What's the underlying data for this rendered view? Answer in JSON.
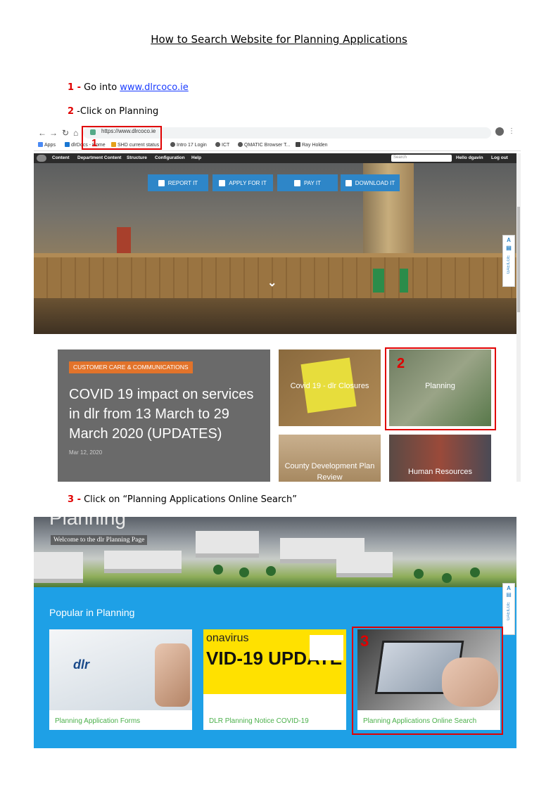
{
  "doc": {
    "title": "How to Search Website for Planning Applications",
    "step1": {
      "num": "1 -",
      "text": " Go into ",
      "link": "www.dlrcoco.ie"
    },
    "step2": {
      "num": "2",
      "text": " -Click on Planning"
    },
    "step3": {
      "num": "3 -",
      "text": " Click on “Planning Applications Online Search”"
    }
  },
  "shot1": {
    "url": "https://www.dlrcoco.ie",
    "bookmarks": [
      "Apps",
      "dlrDocs - Home",
      "SHD current status",
      "Intro 17 Login",
      "ICT",
      "QMATIC Browser T...",
      "Ray Holden"
    ],
    "admin": {
      "items": [
        "Content",
        "Department Content",
        "Structure",
        "Configuration",
        "Help"
      ],
      "search_placeholder": "Search",
      "hello": "Hello dgavin",
      "logout": "Log out"
    },
    "buttons": [
      "REPORT IT",
      "APPLY FOR IT",
      "PAY IT",
      "DOWNLOAD IT"
    ],
    "side_a": "A",
    "side_gaeilge": "GAEILGE",
    "news": {
      "tag": "CUSTOMER CARE & COMMUNICATIONS",
      "headline": "COVID 19 impact on services in dlr from 13 March to 29 March 2020 (UPDATES)",
      "date": "Mar 12, 2020"
    },
    "tiles": [
      "Covid 19 - dlr Closures",
      "Planning",
      "County Development Plan Review",
      "Human Resources"
    ],
    "marker": "1",
    "marker2": "2"
  },
  "shot2": {
    "page_title": "Planning",
    "welcome": "Welcome to the dlr Planning Page",
    "popular": "Popular in Planning",
    "cards": [
      "Planning Application Forms",
      "DLR Planning Notice COVID-19",
      "Planning Applications Online Search"
    ],
    "card2_top": "onavirus",
    "card2_big": "VID-19 UPDATE",
    "card1_logo": "dlr",
    "side_a": "A",
    "side_gaeilge": "GAEILGE",
    "marker": "3"
  }
}
